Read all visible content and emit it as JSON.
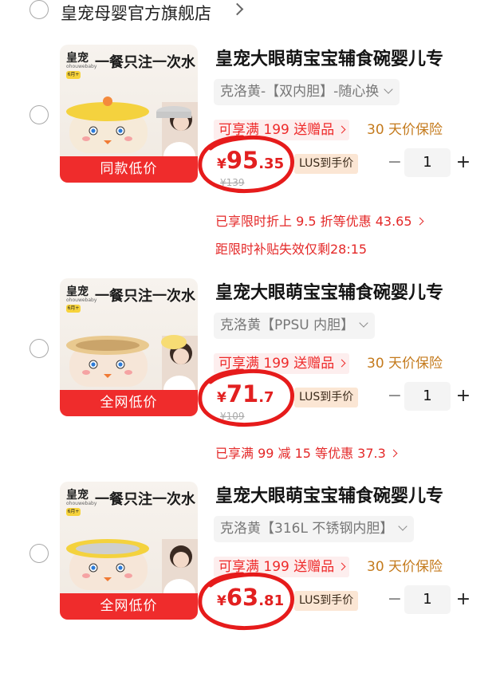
{
  "store": {
    "name": "皇宠母婴官方旗舰店"
  },
  "items": [
    {
      "thumb_brand": "皇宠",
      "thumb_brand_sub": "ohouwebaby",
      "thumb_badge": "6月+",
      "thumb_slogan": "一餐只注一次水",
      "thumb_banner": "同款低价",
      "title": "皇宠大眼萌宝宝辅食碗婴儿专",
      "sku": "克洛黄-【双内胆】-随心换",
      "promo": "可享满 199 送赠品",
      "insurance": "30 天价保险",
      "price_symbol": "¥",
      "price_int": "95",
      "price_dec": ".35",
      "plus_tag": "LUS到手价",
      "original_price": "¥139",
      "quantity": "1",
      "discount": "已享限时折上 9.5 折等优惠 43.65",
      "countdown": "距限时补贴失效仅剩28:15",
      "lid_color": "#f4d23e",
      "body_color": "#f6ead8"
    },
    {
      "thumb_brand": "皇宠",
      "thumb_brand_sub": "ohouwebaby",
      "thumb_badge": "6月+",
      "thumb_slogan": "一餐只注一次水",
      "thumb_banner": "全网低价",
      "title": "皇宠大眼萌宝宝辅食碗婴儿专",
      "sku": "克洛黄【PPSU 内胆】",
      "promo": "可享满 199 送赠品",
      "insurance": "30 天价保险",
      "price_symbol": "¥",
      "price_int": "71",
      "price_dec": ".7",
      "plus_tag": "LUS到手价",
      "original_price": "¥109",
      "quantity": "1",
      "discount": "已享满 99 减 15 等优惠 37.3",
      "lid_color": "#e9c98f",
      "body_color": "#f6e6d8"
    },
    {
      "thumb_brand": "皇宠",
      "thumb_brand_sub": "ohouwebaby",
      "thumb_badge": "6月+",
      "thumb_slogan": "一餐只注一次水",
      "thumb_banner": "全网低价",
      "title": "皇宠大眼萌宝宝辅食碗婴儿专",
      "sku": "克洛黄【316L 不锈钢内胆】",
      "promo": "可享满 199 送赠品",
      "insurance": "30 天价保险",
      "price_symbol": "¥",
      "price_int": "63",
      "price_dec": ".81",
      "plus_tag": "LUS到手价",
      "quantity": "1",
      "lid_color": "#f4d23e",
      "body_color": "#f6e6d8"
    }
  ],
  "colors": {
    "accent_red": "#e22020",
    "banner_red": "#ef2c2c",
    "insurance_orange": "#c47a1c"
  }
}
